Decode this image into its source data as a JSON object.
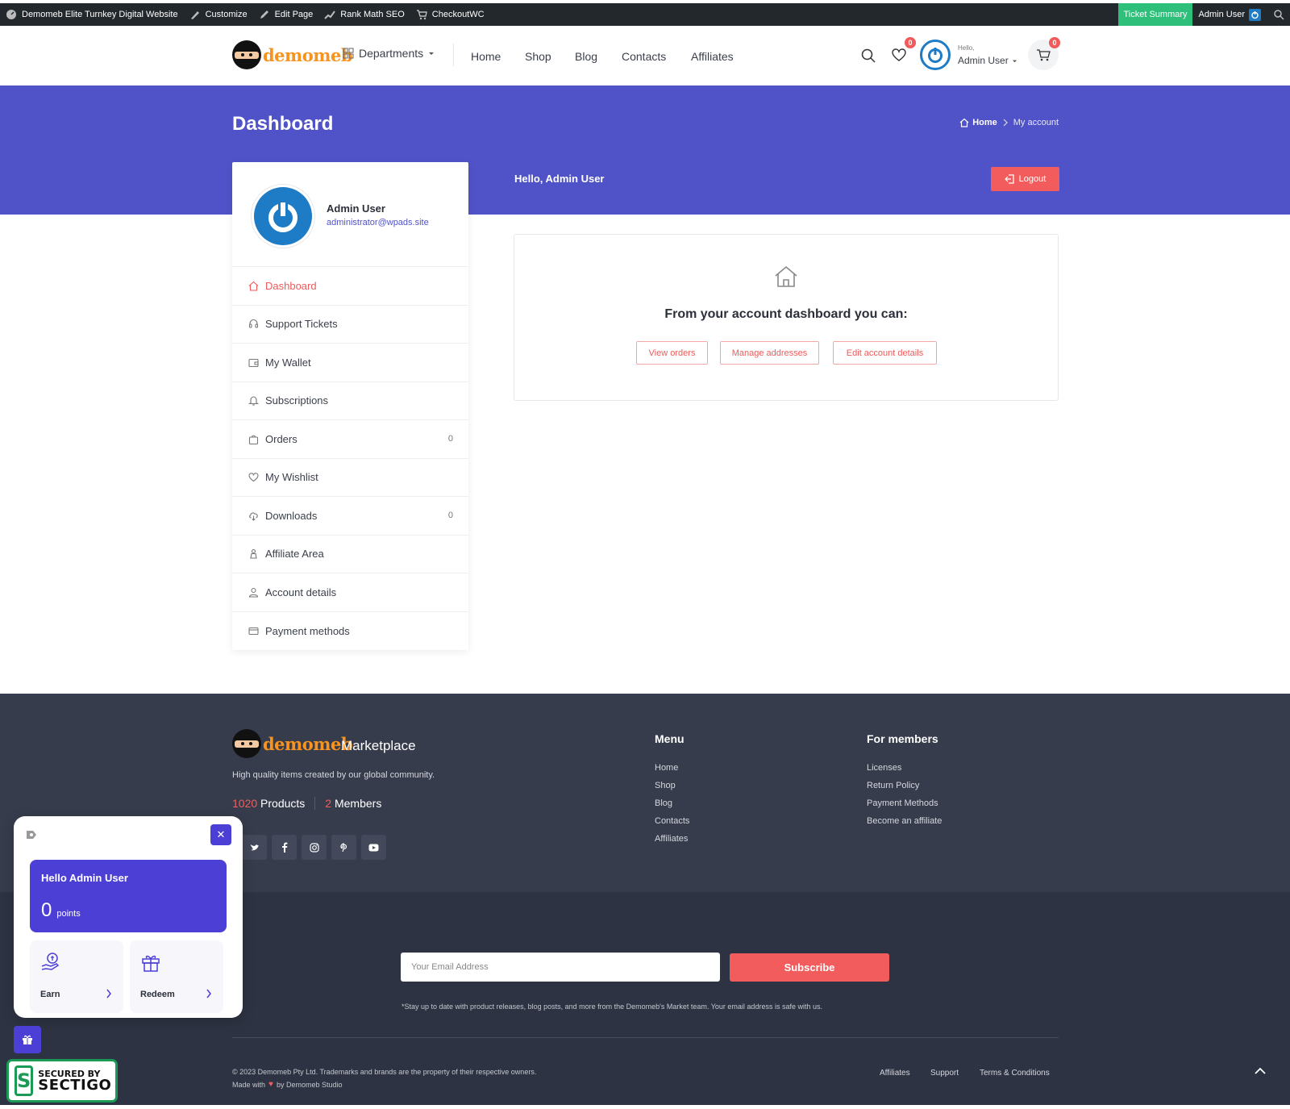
{
  "admin_bar": {
    "site_name": "Demomeb Elite Turnkey Digital Website",
    "customize": "Customize",
    "edit_page": "Edit Page",
    "rank_math": "Rank Math SEO",
    "checkoutwc": "CheckoutWC",
    "ticket_summary": "Ticket Summary",
    "user": "Admin User"
  },
  "header": {
    "logo_text": "demomeb",
    "departments": "Departments",
    "nav": [
      "Home",
      "Shop",
      "Blog",
      "Contacts",
      "Affiliates"
    ],
    "wishlist_count": "0",
    "cart_count": "0",
    "hello_small": "Hello,",
    "user_name": "Admin User"
  },
  "hero": {
    "title": "Dashboard",
    "breadcrumb_home": "Home",
    "breadcrumb_current": "My account",
    "hello": "Hello, Admin User",
    "logout": "Logout"
  },
  "profile": {
    "name": "Admin User",
    "email": "administrator@wpads.site"
  },
  "account_menu": [
    {
      "label": "Dashboard",
      "icon": "home-icon",
      "count": ""
    },
    {
      "label": "Support Tickets",
      "icon": "headset-icon",
      "count": ""
    },
    {
      "label": "My Wallet",
      "icon": "wallet-icon",
      "count": ""
    },
    {
      "label": "Subscriptions",
      "icon": "bell-icon",
      "count": ""
    },
    {
      "label": "Orders",
      "icon": "bag-icon",
      "count": "0"
    },
    {
      "label": "My Wishlist",
      "icon": "heart-icon",
      "count": ""
    },
    {
      "label": "Downloads",
      "icon": "cloud-download-icon",
      "count": "0"
    },
    {
      "label": "Affiliate Area",
      "icon": "affiliate-icon",
      "count": ""
    },
    {
      "label": "Account details",
      "icon": "user-icon",
      "count": ""
    },
    {
      "label": "Payment methods",
      "icon": "credit-card-icon",
      "count": ""
    }
  ],
  "dashboard": {
    "intro": "From your account dashboard you can:",
    "buttons": [
      "View orders",
      "Manage addresses",
      "Edit account details"
    ]
  },
  "footer": {
    "logo_text": "demomeb",
    "marketplace": "Marketplace",
    "description": "High quality items created by our global community.",
    "products_count": "1020",
    "products_label": "Products",
    "members_count": "2",
    "members_label": "Members",
    "menu_title": "Menu",
    "menu_links": [
      "Home",
      "Shop",
      "Blog",
      "Contacts",
      "Affiliates"
    ],
    "members_title": "For members",
    "members_links": [
      "Licenses",
      "Return Policy",
      "Payment Methods",
      "Become an affiliate"
    ],
    "email_placeholder": "Your Email Address",
    "subscribe": "Subscribe",
    "fine_print": "*Stay up to date with product releases, blog posts, and more from the Demomeb's Market team. Your email address is safe with us.",
    "copyright": "© 2023 Demomeb Pty Ltd. Trademarks and brands are the property of their respective owners.",
    "made_with": "Made with",
    "made_by": "by Demomeb Studio",
    "bottom_links": [
      "Affiliates",
      "Support",
      "Terms & Conditions"
    ]
  },
  "points_widget": {
    "hello": "Hello Admin User",
    "points": "0",
    "points_label": "points",
    "earn": "Earn",
    "redeem": "Redeem"
  },
  "sectigo": {
    "line1": "SECURED BY",
    "line2": "SECTIGO"
  },
  "colors": {
    "primary": "#5053c7",
    "accent": "#f25c5c",
    "footer": "#373c4c",
    "widget": "#4b3fd6"
  }
}
